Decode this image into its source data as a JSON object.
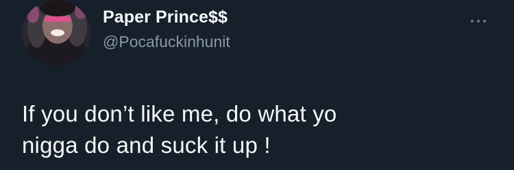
{
  "author": {
    "display_name": "Paper Prince$$",
    "handle": "@Pocafuckinhunit"
  },
  "icons": {
    "avatar": "profile-photo",
    "more": "more-horizontal-icon"
  },
  "tweet": {
    "lines": [
      "If you don’t like me, do what yo",
      "nigga do and suck it up !"
    ]
  },
  "colors": {
    "background": "#15202b",
    "primary_text": "#f7f9f9",
    "secondary_text": "#8b98a5"
  }
}
